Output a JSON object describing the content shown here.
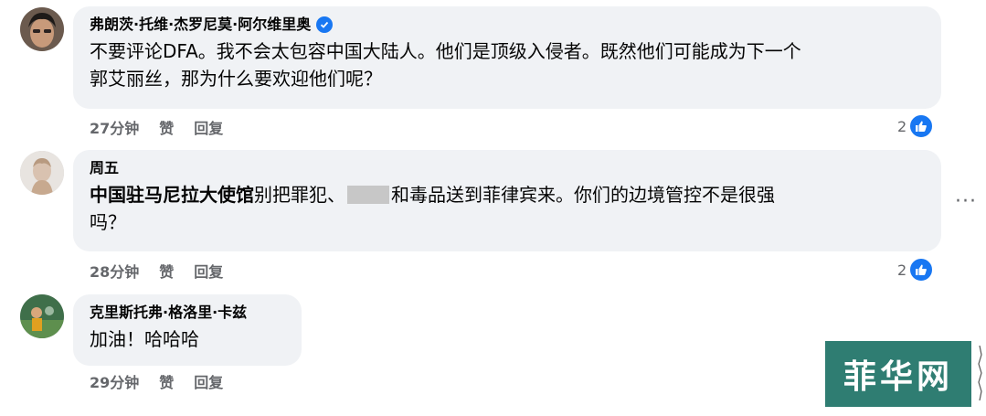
{
  "comments": [
    {
      "author": "弗朗茨·托维·杰罗尼莫·阿尔维里奥",
      "verified": true,
      "text_line1": "不要评论DFA。我不会太包容中国大陆人。他们是顶级入侵者。既然他们可能成为下一个",
      "text_line2": "郭艾丽丝，那为什么要欢迎他们呢？",
      "time": "27分钟",
      "like_label": "赞",
      "reply_label": "回复",
      "reactions": "2"
    },
    {
      "author": "周五",
      "mention": "中国驻马尼拉大使馆",
      "text_part1": "别把罪犯、",
      "text_part2": "和毒品送到菲律宾来。你们的边境管控不是很强",
      "text_line2": "吗？",
      "time": "28分钟",
      "like_label": "赞",
      "reply_label": "回复",
      "reactions": "2"
    },
    {
      "author": "克里斯托弗·格洛里·卡兹",
      "text": "加油！哈哈哈",
      "time": "29分钟",
      "like_label": "赞",
      "reply_label": "回复"
    }
  ],
  "more_options": "···",
  "watermark": "菲华网",
  "colors": {
    "bubble": "#f0f2f5",
    "secondary_text": "#65676b",
    "like_blue": "#1877f2",
    "watermark_bg": "#2f7d72"
  }
}
